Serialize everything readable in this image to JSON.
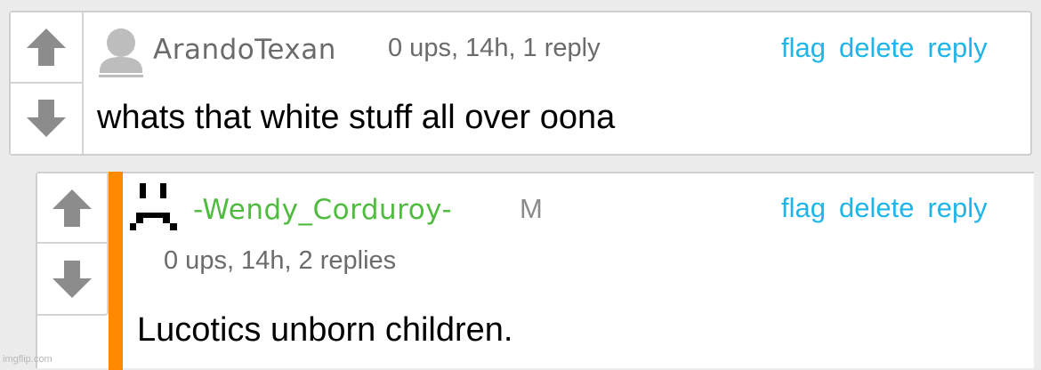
{
  "comments": [
    {
      "username": "ArandoTexan",
      "avatar": "default-user-icon",
      "meta": "0 ups, 14h, 1 reply",
      "badge": "",
      "actions": {
        "flag": "flag",
        "delete": "delete",
        "reply": "reply"
      },
      "text": "whats that white stuff all over oona",
      "username_color": "#6b6b6b"
    },
    {
      "username": "-Wendy_Corduroy-",
      "avatar": "sad-face-pixel-icon",
      "meta": "0 ups, 14h, 2 replies",
      "badge": "M",
      "actions": {
        "flag": "flag",
        "delete": "delete",
        "reply": "reply"
      },
      "text": "Lucotics unborn children.",
      "username_color": "#4fbb3f",
      "op_marker_color": "#ff8a00"
    }
  ],
  "icons": {
    "upvote": "arrow-up-icon",
    "downvote": "arrow-down-icon"
  },
  "colors": {
    "link": "#1fb5ea",
    "meta": "#6b6b6b",
    "background": "#ececec"
  },
  "watermark": "imgflip.com"
}
